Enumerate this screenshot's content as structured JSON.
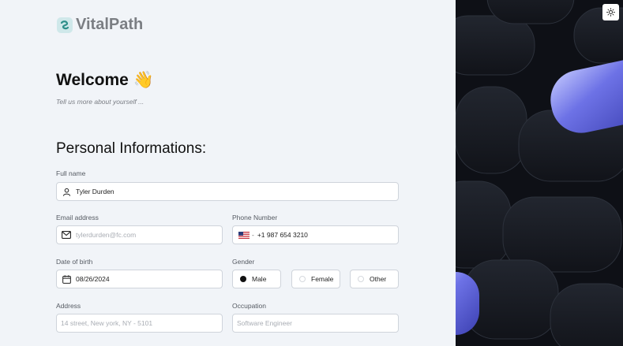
{
  "brand": {
    "name": "VitalPath"
  },
  "header": {
    "welcome": "Welcome",
    "wave_emoji": "👋",
    "subtitle": "Tell us more about yourself ..."
  },
  "section_title": "Personal Informations:",
  "form": {
    "full_name": {
      "label": "Full name",
      "value": "Tyler Durden"
    },
    "email": {
      "label": "Email address",
      "placeholder": "tylerdurden@fc.com"
    },
    "phone": {
      "label": "Phone Number",
      "value": "+1 987 654 3210",
      "country_separator": "-"
    },
    "dob": {
      "label": "Date of birth",
      "value": "08/26/2024"
    },
    "gender": {
      "label": "Gender",
      "options": [
        "Male",
        "Female",
        "Other"
      ],
      "selected": "Male"
    },
    "address": {
      "label": "Address",
      "placeholder": "14 street, New york, NY - 5101"
    },
    "occupation": {
      "label": "Occupation",
      "placeholder": "Software Engineer"
    }
  },
  "icons": [
    "user-icon",
    "mail-icon",
    "us-flag-icon",
    "calendar-icon",
    "sun-icon"
  ]
}
